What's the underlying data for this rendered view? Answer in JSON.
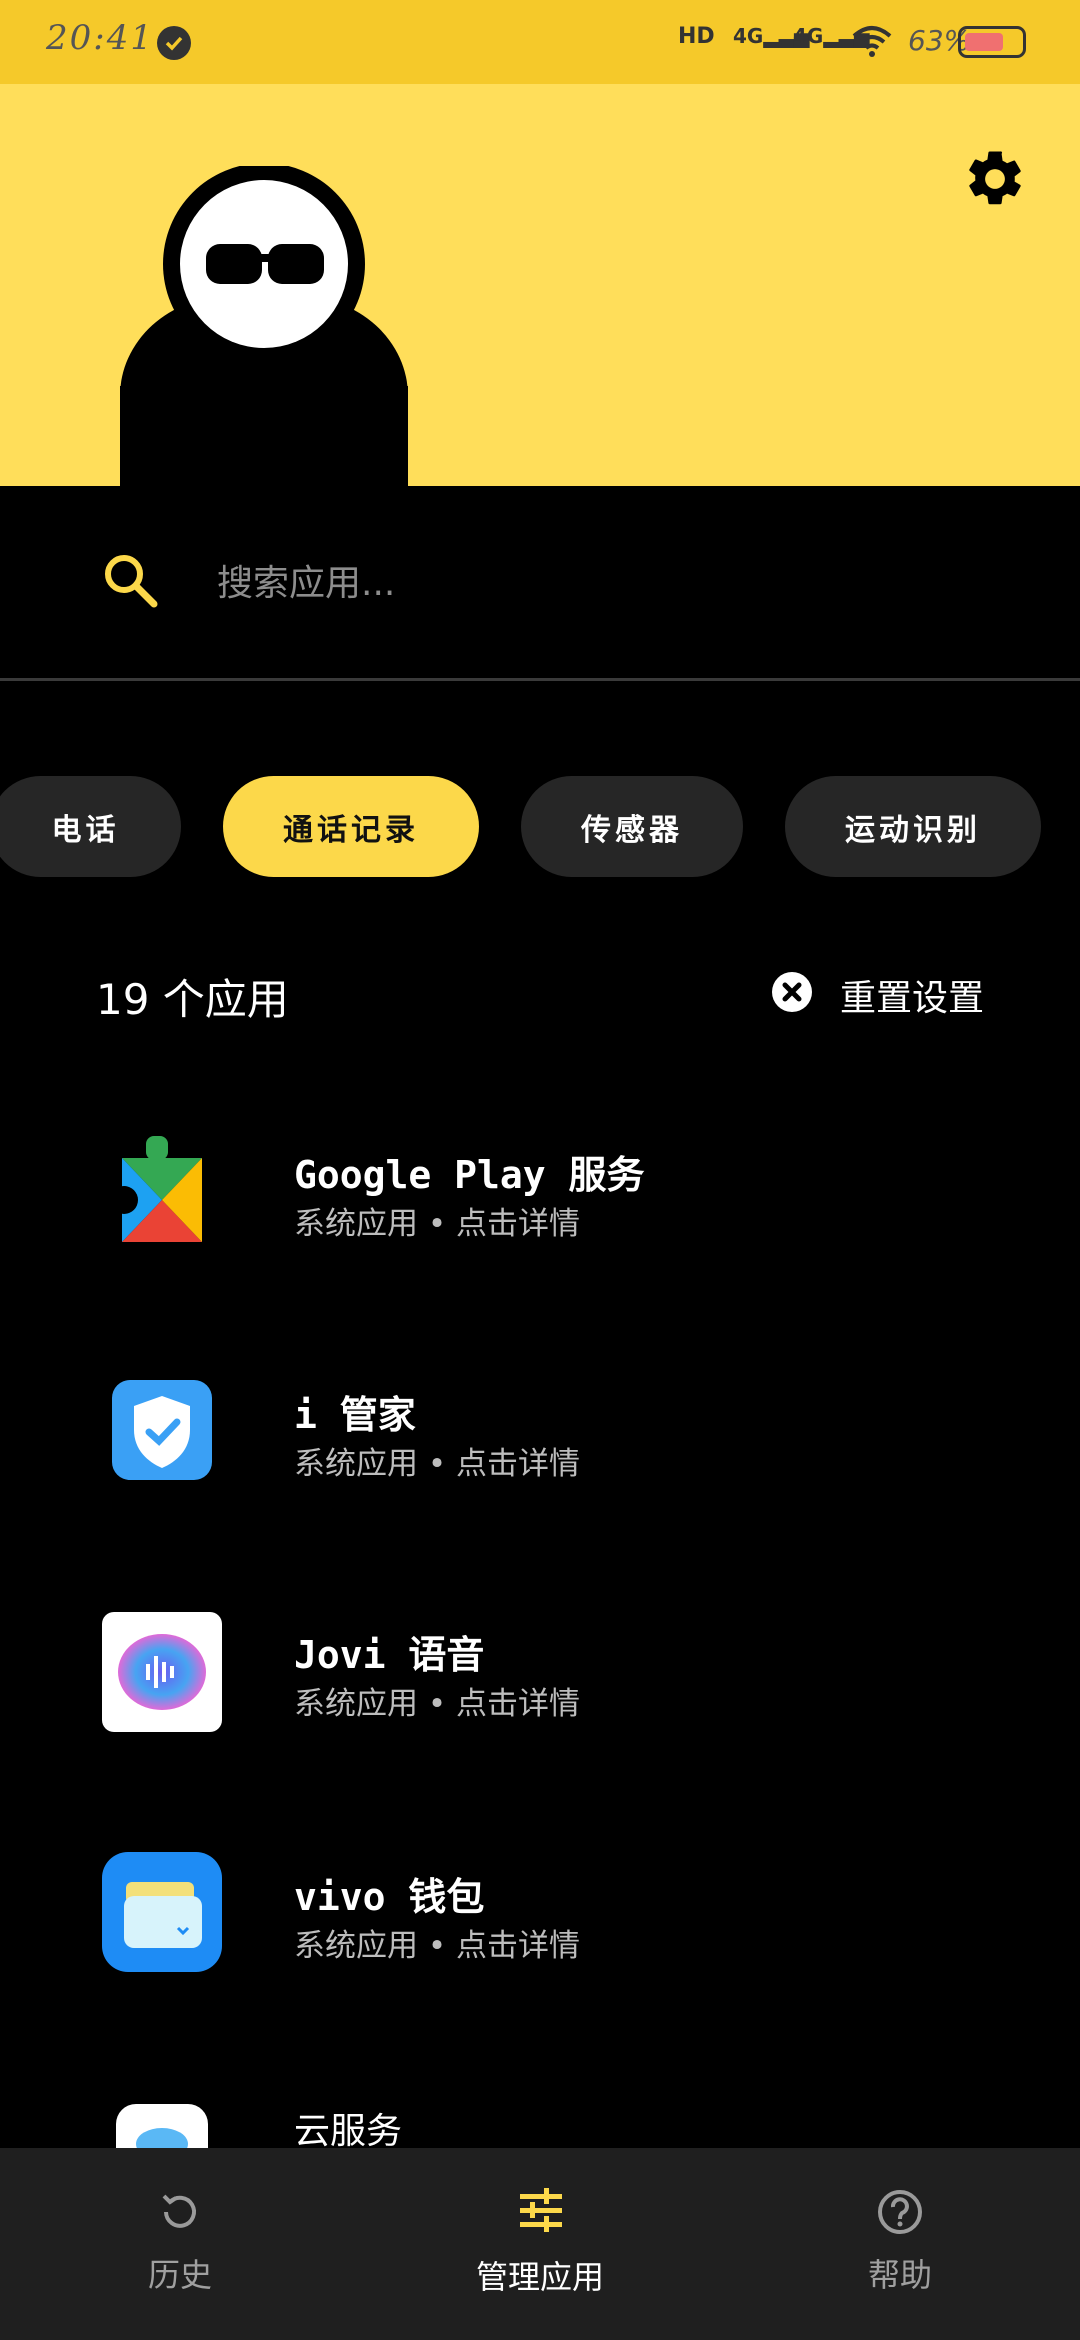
{
  "status_bar": {
    "time": "20:41",
    "battery": "63%"
  },
  "search": {
    "placeholder": "搜索应用..."
  },
  "chips": [
    "电话",
    "通话记录",
    "传感器",
    "运动识别"
  ],
  "summary": {
    "count_label": "19 个应用",
    "reset_label": "重置设置"
  },
  "apps": [
    {
      "title": "Google Play 服务",
      "subtitle": "系统应用 • 点击详情"
    },
    {
      "title": "i 管家",
      "subtitle": "系统应用 • 点击详情"
    },
    {
      "title": "Jovi 语音",
      "subtitle": "系统应用 • 点击详情"
    },
    {
      "title": "vivo 钱包",
      "subtitle": "系统应用 • 点击详情"
    },
    {
      "title": "云服务",
      "subtitle": ""
    }
  ],
  "bottom_nav": [
    {
      "label": "历史",
      "icon": "history-icon"
    },
    {
      "label": "管理应用",
      "icon": "tune-icon",
      "active": true
    },
    {
      "label": "帮助",
      "icon": "help-icon"
    }
  ],
  "colors": {
    "accent": "#fcd84a",
    "header_bg": "#ffde5a",
    "status_bg": "#f5c92a",
    "chip_bg": "#262626",
    "nav_bg": "#1f1f1f"
  }
}
